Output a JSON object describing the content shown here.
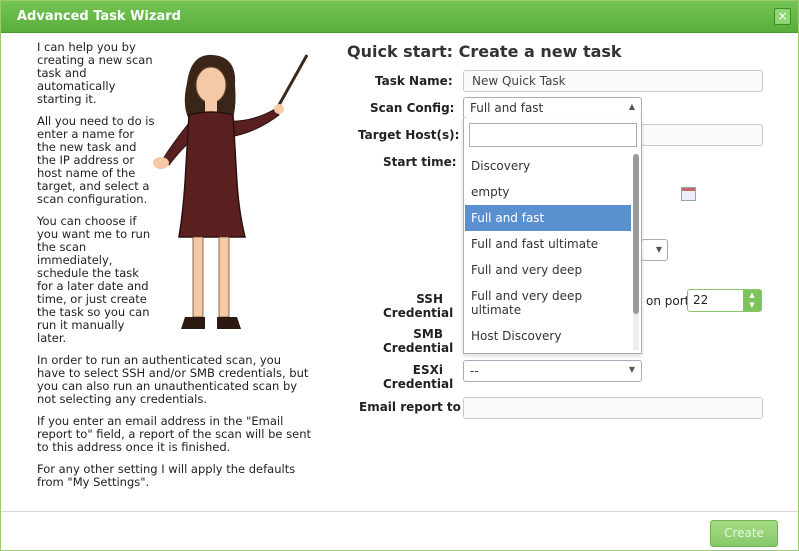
{
  "window": {
    "title": "Advanced Task Wizard",
    "close_label": "×"
  },
  "intro": {
    "p1": "I can help you by creating a new scan task and automatically starting it.",
    "p2": "All you need to do is enter a name for the new task and the IP address or host name of the target, and select a scan configuration.",
    "p3": "You can choose if you want me to run the scan immediately, schedule the task for a later date and time, or just create the task so you can run it manually later.",
    "p4": "In order to run an authenticated scan, you have to select SSH and/or SMB credentials, but you can also run an unauthenticated scan by not selecting any credentials.",
    "p5": "If you enter an email address in the \"Email report to\" field, a report of the scan will be sent to this address once it is finished.",
    "p6": "For any other setting I will apply the defaults from \"My Settings\"."
  },
  "form": {
    "title": "Quick start: Create a new task",
    "task_name_label": "Task Name:",
    "task_name_value": "New Quick Task",
    "scan_config_label": "Scan Config:",
    "scan_config_value": "Full and fast",
    "target_label": "Target Host(s):",
    "start_time_label": "Start time:",
    "ssh_label": "SSH Credential",
    "on_port_label": "on port",
    "port_value": "22",
    "smb_label": "SMB Credential",
    "esxi_label": "ESXi Credential",
    "esxi_value": "--",
    "email_label": "Email report to"
  },
  "dropdown": {
    "options": [
      "Discovery",
      "empty",
      "Full and fast",
      "Full and fast ultimate",
      "Full and very deep",
      "Full and very deep ultimate",
      "Host Discovery"
    ],
    "selected_index": 2
  },
  "footer": {
    "create_label": "Create"
  },
  "colors": {
    "titlebar": "#5aae3c",
    "selected_option": "#5a8fd0",
    "create_button": "#86c96a"
  }
}
